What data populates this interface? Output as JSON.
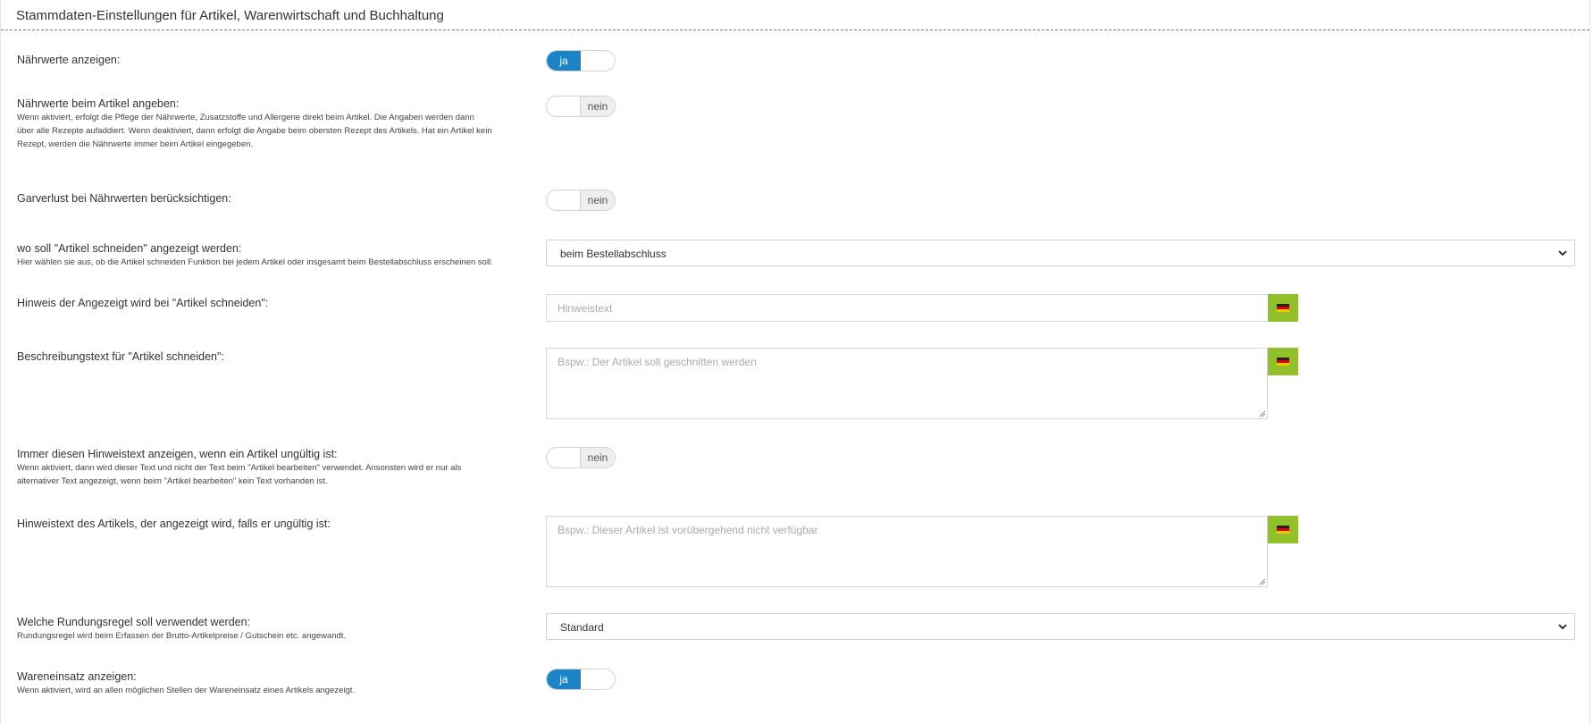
{
  "panel": {
    "title": "Stammdaten-Einstellungen für Artikel, Warenwirtschaft und Buchhaltung"
  },
  "settings": {
    "naehrwerte_anzeigen": {
      "label": "Nährwerte anzeigen:",
      "value_label": "ja",
      "state": "on"
    },
    "naehrwerte_artikel": {
      "label": "Nährwerte beim Artikel angeben:",
      "desc1": "Wenn aktiviert, erfolgt die Pflege der Nährwerte, Zusatzstoffe und Allergene direkt beim Artikel. Die Angaben werden dann",
      "desc2": "über alle Rezepte aufaddiert. Wenn deaktiviert, dann erfolgt die Angabe beim obersten Rezept des Artikels. Hat ein Artikel kein",
      "desc3": "Rezept, werden die Nährwerte immer beim Artikel eingegeben.",
      "value_label": "nein",
      "state": "off"
    },
    "garverlust": {
      "label": "Garverlust bei Nährwerten berücksichtigen:",
      "value_label": "nein",
      "state": "off"
    },
    "artikel_schneiden_ort": {
      "label": "wo soll \"Artikel schneiden\" angezeigt werden:",
      "desc1": "Hier wählen sie aus, ob die Artikel schneiden Funktion bei jedem Artikel oder insgesamt beim Bestellabschluss erscheinen soll.",
      "selected": "beim Bestellabschluss"
    },
    "hinweis_schneiden": {
      "label": "Hinweis der Angezeigt wird bei \"Artikel schneiden\":",
      "placeholder": "Hinweistext",
      "value": ""
    },
    "beschreibung_schneiden": {
      "label": "Beschreibungstext für \"Artikel schneiden\":",
      "placeholder": "Bspw.: Der Artikel soll geschnitten werden",
      "value": ""
    },
    "hinweis_immer": {
      "label": "Immer diesen Hinweistext anzeigen, wenn ein Artikel ungültig ist:",
      "desc1": "Wenn aktiviert, dann wird dieser Text und nicht der Text beim \"Artikel bearbeiten\" verwendet. Ansonsten wird er nur als",
      "desc2": "alternativer Text angezeigt, wenn beim \"Artikel bearbeiten\" kein Text vorhanden ist.",
      "value_label": "nein",
      "state": "off"
    },
    "hinweis_ungueltig": {
      "label": "Hinweistext des Artikels, der angezeigt wird, falls er ungültig ist:",
      "placeholder": "Bspw.: Dieser Artikel ist vorübergehend nicht verfügbar",
      "value": ""
    },
    "rundungsregel": {
      "label": "Welche Rundungsregel soll verwendet werden:",
      "desc1": "Rundungsregel wird beim Erfassen der Brutto-Artikelpreise / Gutschein etc. angewandt.",
      "selected": "Standard"
    },
    "wareneinsatz": {
      "label": "Wareneinsatz anzeigen:",
      "desc1": "Wenn aktiviert, wird an allen möglichen Stellen der Wareneinsatz eines Artikels angezeigt.",
      "value_label": "ja",
      "state": "on"
    }
  },
  "icons": {
    "language_flag": "flag-de-icon",
    "select_arrow": "chevron-down-icon"
  },
  "colors": {
    "toggle_on": "#1a84c7",
    "flag_button": "#92c02b"
  }
}
